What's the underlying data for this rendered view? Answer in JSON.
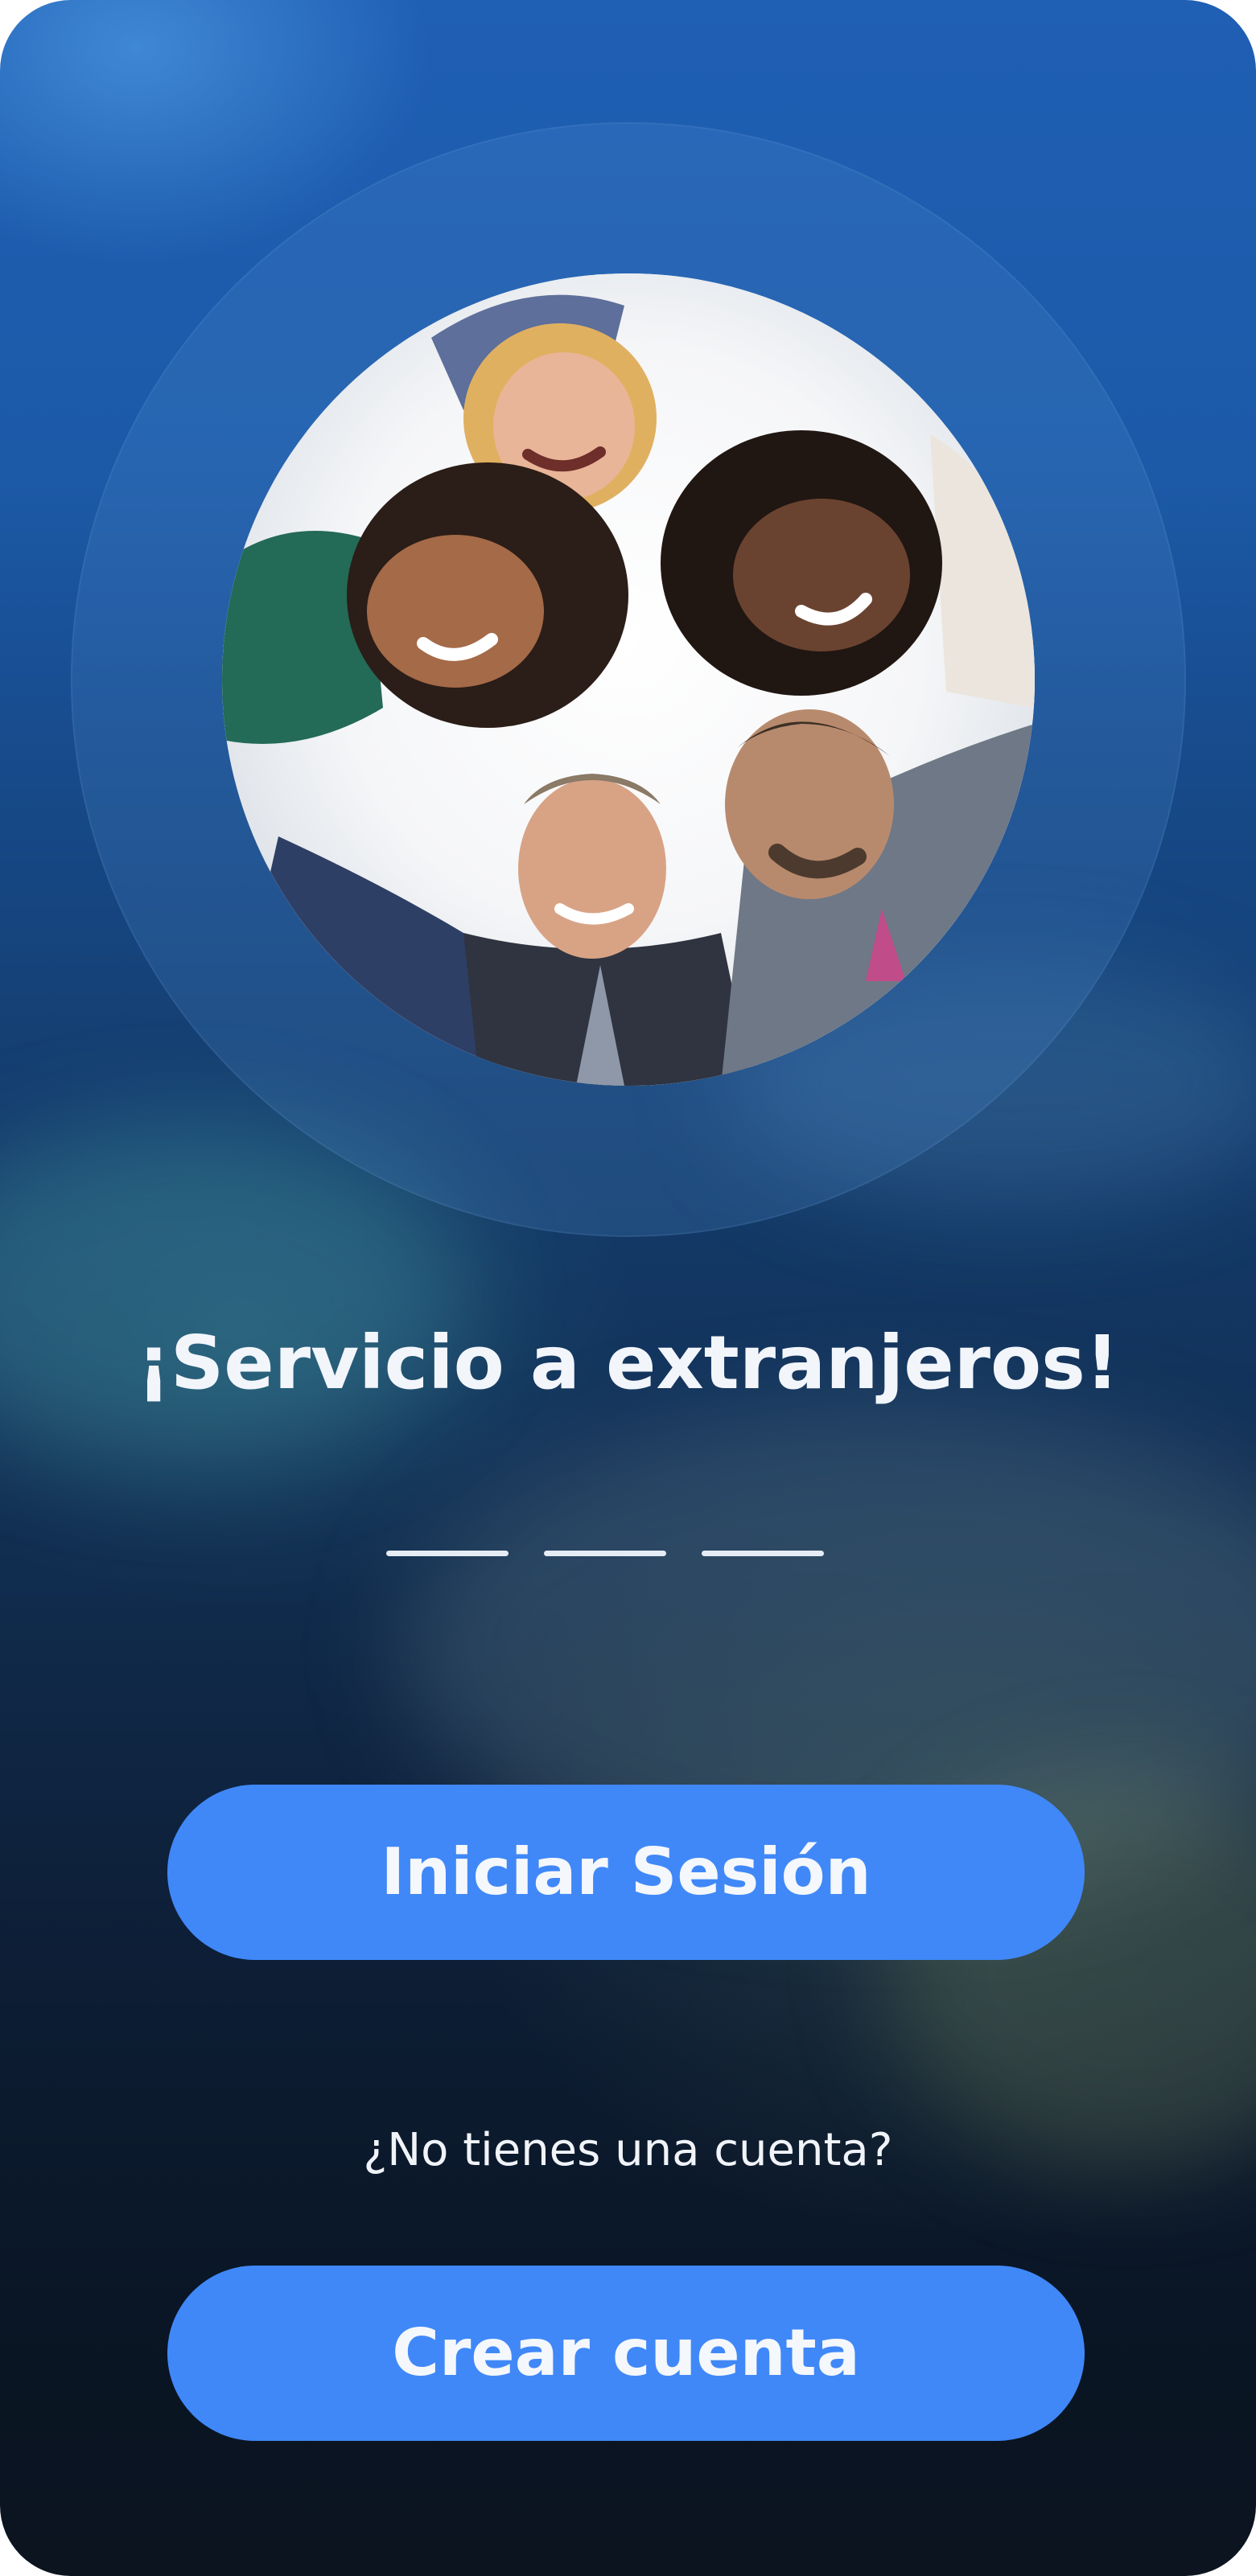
{
  "welcome": {
    "headline": "¡Servicio a extranjeros!",
    "hero_image": "group-of-people-huddle-photo"
  },
  "pager": {
    "count": 3,
    "active_index": 0
  },
  "actions": {
    "login_label": "Iniciar Sesión",
    "no_account_text": "¿No tienes una cuenta?",
    "create_label": "Crear cuenta"
  },
  "colors": {
    "button": "#4088f8",
    "background_top": "#1f5fb4",
    "background_bottom": "#0c1420",
    "text": "#f2f5fa"
  }
}
